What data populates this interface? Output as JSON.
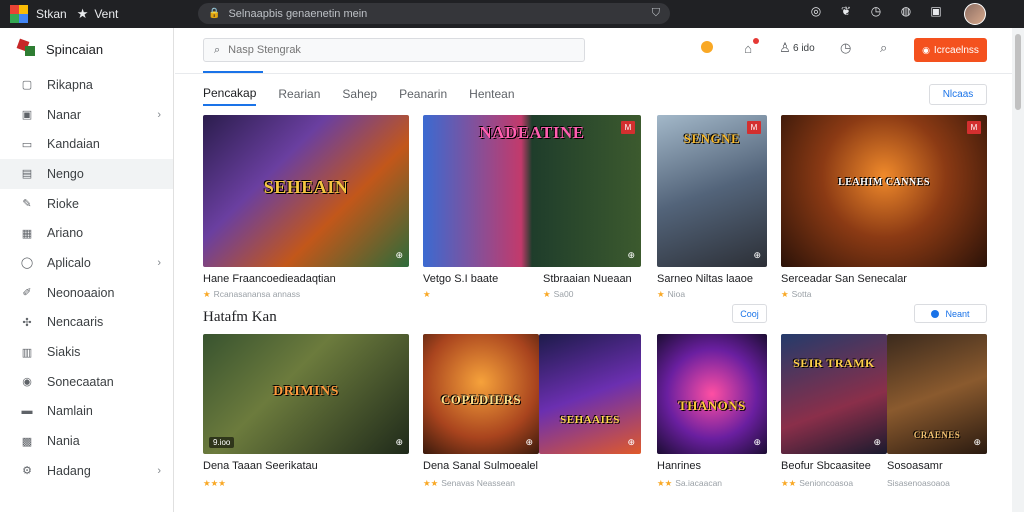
{
  "topbar": {
    "app_title": "Stkan",
    "window_title": "Vent",
    "address": "Selnaapbis genaenetin mein",
    "icons": [
      "target-icon",
      "leaf-icon",
      "clock-icon",
      "globe-icon",
      "gift-icon"
    ]
  },
  "sidebar": {
    "title": "Spincaian",
    "items": [
      {
        "label": "Rikapna",
        "icon": "box-icon",
        "chevron": false,
        "active": false
      },
      {
        "label": "Nanar",
        "icon": "square-icon",
        "chevron": true,
        "active": false
      },
      {
        "label": "Kandaian",
        "icon": "tv-icon",
        "chevron": false,
        "active": false
      },
      {
        "label": "Nengo",
        "icon": "monitor-icon",
        "chevron": false,
        "active": true
      },
      {
        "label": "Rioke",
        "icon": "edit-icon",
        "chevron": false,
        "active": false
      },
      {
        "label": "Ariano",
        "icon": "image-icon",
        "chevron": false,
        "active": false
      },
      {
        "label": "Aplicalo",
        "icon": "circle-icon",
        "chevron": true,
        "active": false
      },
      {
        "label": "Neonoaaion",
        "icon": "pen-icon",
        "chevron": false,
        "active": false
      },
      {
        "label": "Nencaaris",
        "icon": "gamepad-icon",
        "chevron": false,
        "active": false
      },
      {
        "label": "Siakis",
        "icon": "chart-icon",
        "chevron": false,
        "active": false
      },
      {
        "label": "Sonecaatan",
        "icon": "pin-icon",
        "chevron": false,
        "active": false
      },
      {
        "label": "Namlain",
        "icon": "folder-icon",
        "chevron": false,
        "active": false
      },
      {
        "label": "Nania",
        "icon": "grid-icon",
        "chevron": false,
        "active": false
      },
      {
        "label": "Hadang",
        "icon": "gear-icon",
        "chevron": true,
        "active": false
      }
    ]
  },
  "header": {
    "search_placeholder": "Nasp Stengrak",
    "count": "6 ido",
    "button_label": "Icrcaelnss"
  },
  "tabs": [
    {
      "label": "Pencakap",
      "active": true
    },
    {
      "label": "Rearian",
      "active": false
    },
    {
      "label": "Sahep",
      "active": false
    },
    {
      "label": "Peanarin",
      "active": false
    },
    {
      "label": "Hentean",
      "active": false
    }
  ],
  "tab_action": "Nlcaas",
  "row1": [
    {
      "title": "Hane Fraancoedieadaqtian",
      "meta": "Rcanasanansa annass",
      "stars": "★",
      "art_text": "SEHEAIN",
      "badge": ""
    },
    {
      "title": "Vetgo S.I baate",
      "meta": "",
      "stars": "★",
      "art_text": "NADEATINE",
      "badge": "M"
    },
    {
      "title": "Stbraaian Nueaan",
      "meta": "Sa00",
      "stars": "★",
      "art_text": "",
      "badge": ""
    },
    {
      "title": "Sarneo Niltas laaoe",
      "meta": "Nioa",
      "stars": "★",
      "art_text": "SENGNE",
      "badge": "M"
    },
    {
      "title": "Serceadar San Senecalar",
      "meta": "Sotta",
      "stars": "★",
      "art_text": "LEAHIM CANNES",
      "badge": "M"
    }
  ],
  "section2": {
    "title": "Hatafm Kan",
    "btn1": "Cooj",
    "btn2": "Neant"
  },
  "row2": [
    {
      "title": "Dena Taaan Seerikatau",
      "meta": "",
      "stars": "★★★",
      "art_text": "DRIMINS",
      "tag": "9.ioo"
    },
    {
      "title": "Dena Sanal Sulmoealel",
      "meta": "Senavas Neassean",
      "stars": "★★",
      "art_text": "COPEDIERS",
      "tag": ""
    },
    {
      "title": "",
      "meta": "",
      "stars": "",
      "art_text": "SEHAAIES",
      "tag": ""
    },
    {
      "title": "Hanrines",
      "meta": "Sa.iacaacan",
      "stars": "★★",
      "art_text": "THANONS",
      "tag": ""
    },
    {
      "title": "Beofur Sbcaasitee",
      "meta": "Senioncoasoa",
      "stars": "★★",
      "art_text": "SEIR TRAMK",
      "tag": ""
    },
    {
      "title": "Sosoasamr",
      "meta": "Sisasenoasoaoa",
      "stars": "",
      "art_text": "CRAENES",
      "tag": ""
    }
  ],
  "colors": {
    "accent": "#1a73e8",
    "primary_button": "#f4511e",
    "star": "#f9a825",
    "badge": "#d32f2f"
  }
}
